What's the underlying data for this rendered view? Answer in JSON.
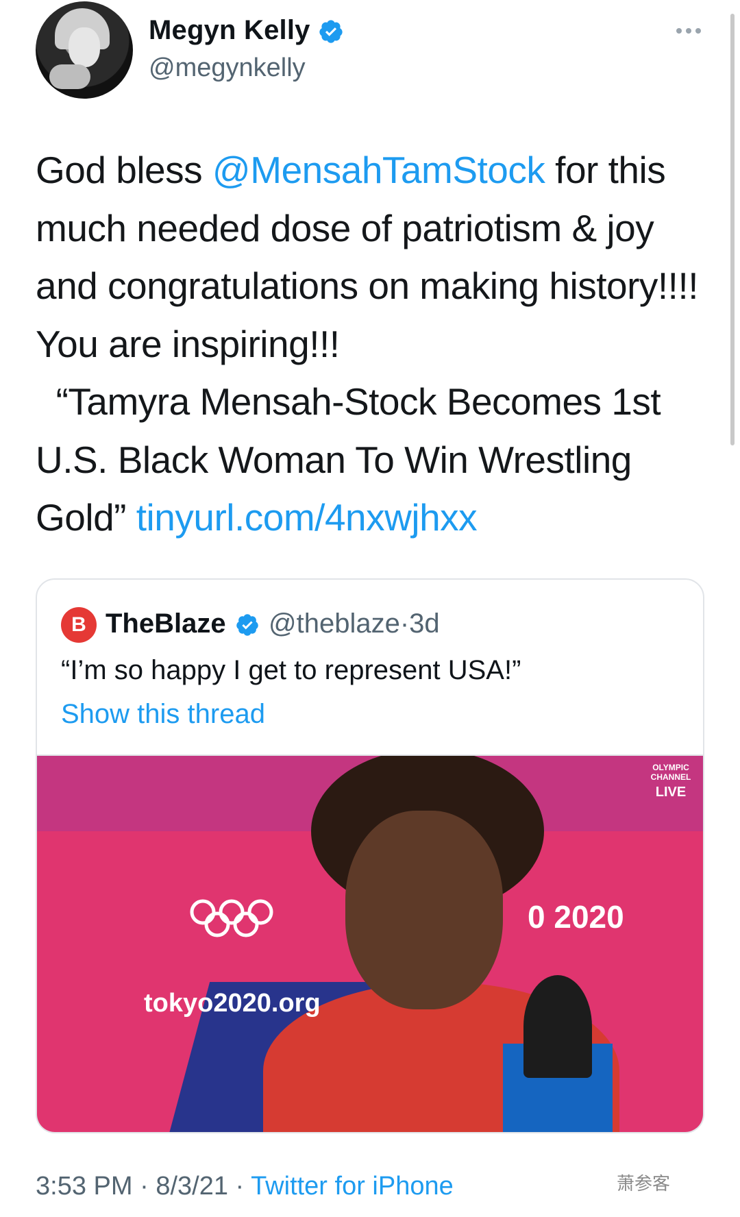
{
  "author": {
    "name": "Megyn Kelly",
    "handle": "@megynkelly"
  },
  "tweet": {
    "text_before_mention": "God bless ",
    "mention": "@MensahTamStock",
    "text_after_mention": " for this much needed dose of patriotism & joy and congratulations on making history!!!! You are inspiring!!!\n  “Tamyra Mensah-Stock Becomes 1st U.S. Black Woman To Win Wrestling Gold” ",
    "link": "tinyurl.com/4nxwjhxx"
  },
  "quoted_tweet": {
    "name": "TheBlaze",
    "handle": "@theblaze",
    "separator": "·",
    "age": "3d",
    "text": "“I’m so happy I get to represent USA!”",
    "show_thread": "Show this thread",
    "media": {
      "url_overlay": "tokyo2020.org",
      "year_overlay": "0 2020",
      "channel_label": "OLYMPIC CHANNEL",
      "live_label": "LIVE"
    }
  },
  "footer": {
    "time": "3:53 PM",
    "separator": " · ",
    "date": "8/3/21",
    "source": "Twitter for iPhone"
  },
  "watermark": "萧参客",
  "colors": {
    "link_blue": "#1d9bf0",
    "verified_blue": "#1d9bf0",
    "blaze_red": "#e53935"
  },
  "icons": [
    "verified-badge-icon",
    "more-options-icon",
    "olympic-rings-icon",
    "blaze-logo-icon"
  ]
}
